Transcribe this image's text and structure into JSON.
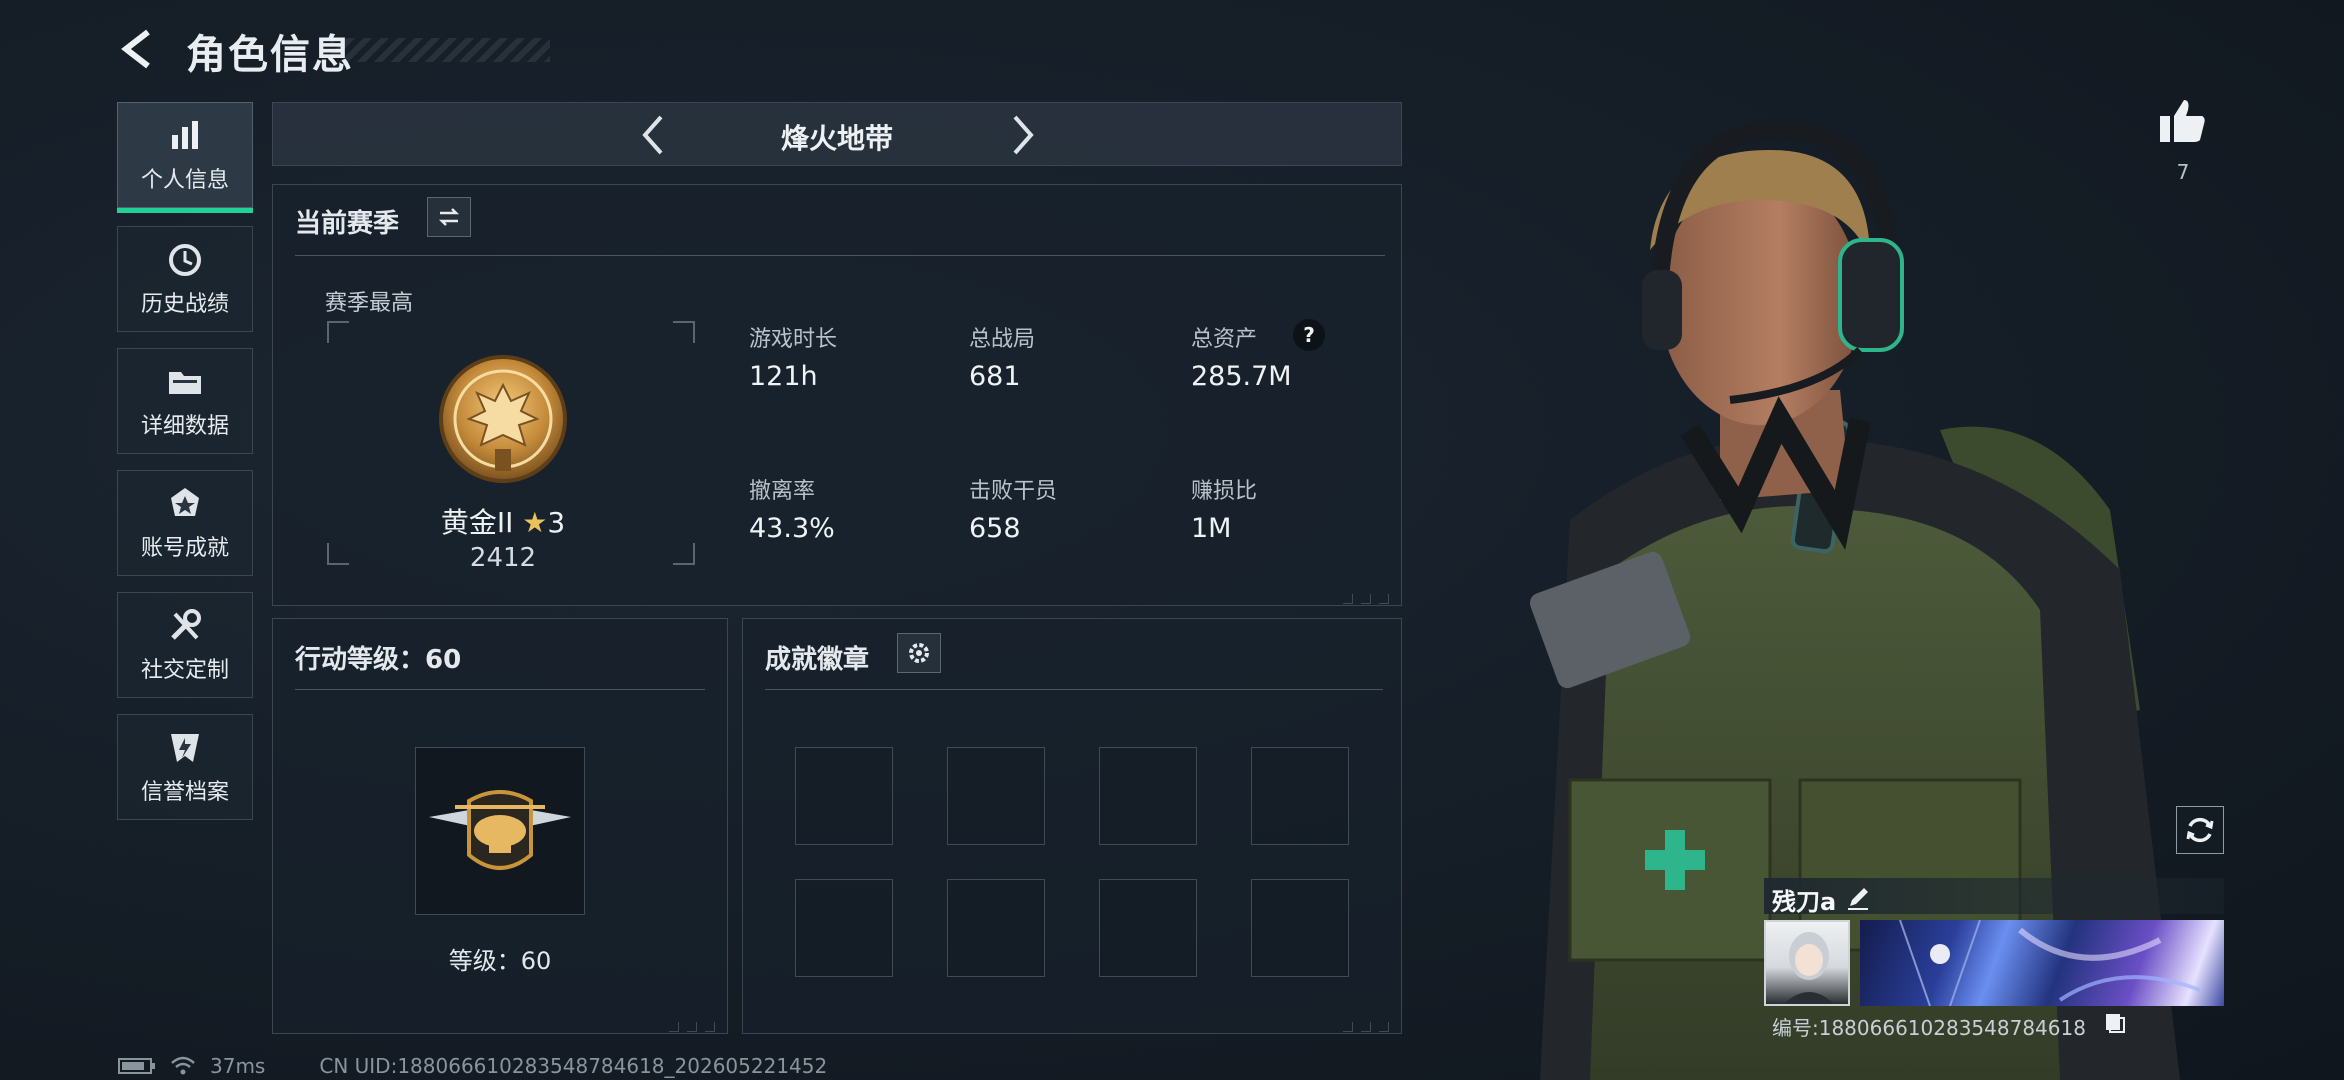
{
  "header": {
    "title": "角色信息"
  },
  "sidebar": {
    "items": [
      {
        "label": "个人信息",
        "icon": "bar-chart-icon",
        "active": true
      },
      {
        "label": "历史战绩",
        "icon": "history-clock-icon"
      },
      {
        "label": "详细数据",
        "icon": "folder-icon"
      },
      {
        "label": "账号成就",
        "icon": "achievement-badge-icon"
      },
      {
        "label": "社交定制",
        "icon": "tools-icon"
      },
      {
        "label": "信誉档案",
        "icon": "credit-shield-icon"
      }
    ]
  },
  "mode": {
    "title": "烽火地带"
  },
  "season": {
    "title": "当前赛季",
    "peak_label": "赛季最高",
    "rank_name": "黄金II",
    "rank_stars": "3",
    "rank_score": "2412",
    "stats": [
      {
        "label": "游戏时长",
        "value": "121h"
      },
      {
        "label": "总战局",
        "value": "681"
      },
      {
        "label": "总资产",
        "value": "285.7M"
      },
      {
        "label": "撤离率",
        "value": "43.3%"
      },
      {
        "label": "击败干员",
        "value": "658"
      },
      {
        "label": "赚损比",
        "value": "1M"
      }
    ],
    "help_glyph": "?"
  },
  "level": {
    "title": "行动等级：60",
    "caption": "等级：60"
  },
  "badges": {
    "title": "成就徽章",
    "slots": 8
  },
  "profile": {
    "likes": "7",
    "player_name": "残刀a",
    "uid_text": "编号:1880666102835487846​18"
  },
  "status": {
    "ping": "37ms",
    "uid_line": "CN UID:1880666102835487846​18_202605221452"
  },
  "colors": {
    "accent": "#1fd397",
    "gold": "#c9953a"
  }
}
